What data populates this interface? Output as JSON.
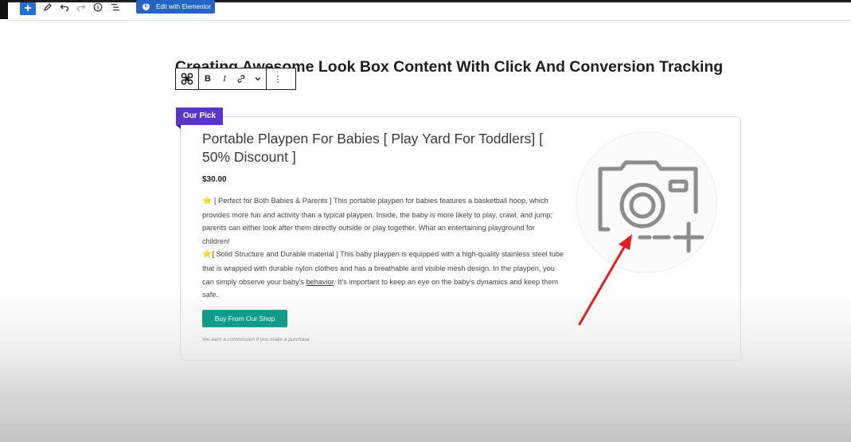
{
  "editor_toolbar": {
    "add_label": "+",
    "elementor_button_label": "Edit with Elementor",
    "elementor_logo": "E"
  },
  "post": {
    "title": "Creating Awesome Look Box Content With Click And Conversion Tracking"
  },
  "block_toolbar": {
    "bold_label": "B",
    "italic_label": "I",
    "more_label": "⋮"
  },
  "product": {
    "badge": "Our Pick",
    "title": "Portable Playpen For Babies [ Play Yard For Toddlers] [ 50% Discount ]",
    "price": "$30.00",
    "description_1": "[ Perfect for Both Babies & Parents ] This portable playpen for babies features a basketball hoop, which provides more fun and activity than a typical playpen. Inside, the baby is more likely to play, crawl, and jump; parents can either look after them directly outside or play together. What an entertaining playground for children!",
    "description_2_a": "[ Solid Structure and Durable material ] This baby playpen is equipped with a high-quality stainless steel tube that is wrapped with durable nylon clothes and has a breathable and visible mesh design. In the playpen, you can simply observe your baby's ",
    "description_2_link": "behavior",
    "description_2_b": ". It's important to keep an eye on the baby's dynamics and keep them safe.",
    "star_glyph": "⭐",
    "buy_button": "Buy From Our Shop",
    "disclaimer": "We earn a commission if you make a purchase ."
  },
  "colors": {
    "badge": "#5b34d0",
    "buy_button": "#0f9d8a",
    "elementor_button": "#2364c5",
    "annotation_arrow": "#e81c1c"
  },
  "icons": [
    "plus-icon",
    "pencil-icon",
    "undo-icon",
    "redo-icon",
    "info-icon",
    "list-view-icon",
    "elementor-logo-icon",
    "block-type-icon",
    "link-icon",
    "chevron-down-icon",
    "more-options-icon",
    "camera-plus-icon"
  ]
}
